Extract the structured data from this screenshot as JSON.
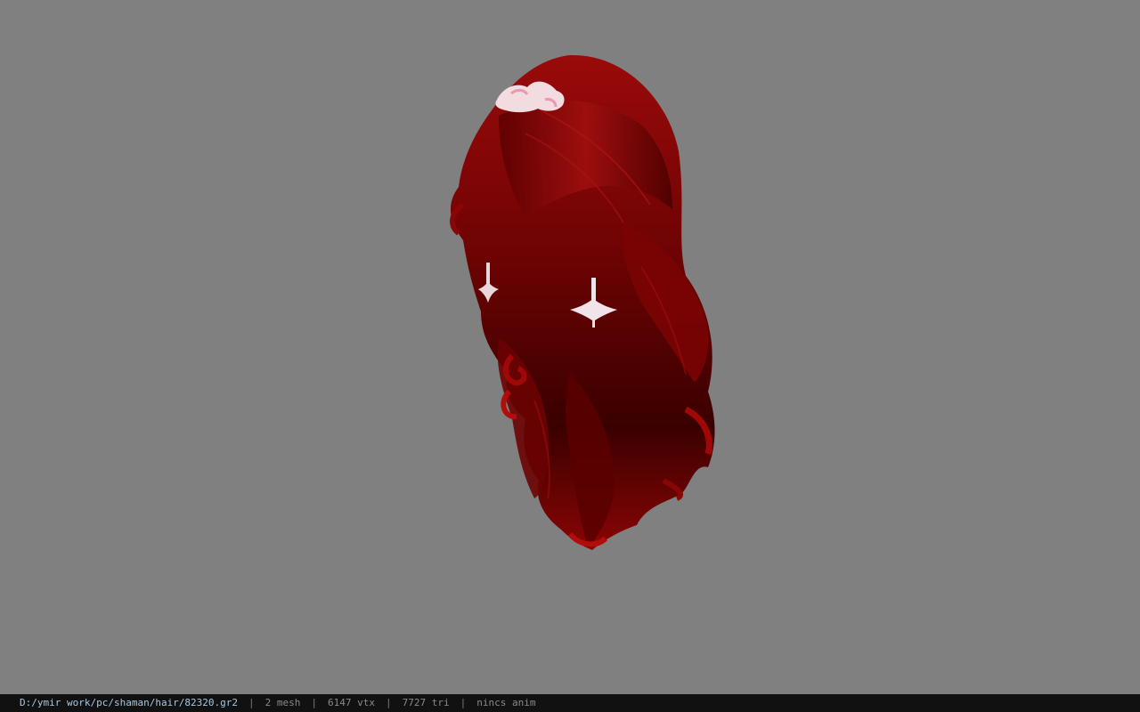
{
  "viewport": {
    "background": "#808080",
    "model": "hair-mesh",
    "hair_color": "#8b0000",
    "ornament_color": "#f2dce0"
  },
  "statusbar": {
    "file_path": "D:/ymir work/pc/shaman/hair/82320.gr2",
    "separator": "|",
    "mesh_count": "2 mesh",
    "vertex_count": "6147 vtx",
    "triangle_count": "7727 tri",
    "anim_status": "nincs anim"
  }
}
